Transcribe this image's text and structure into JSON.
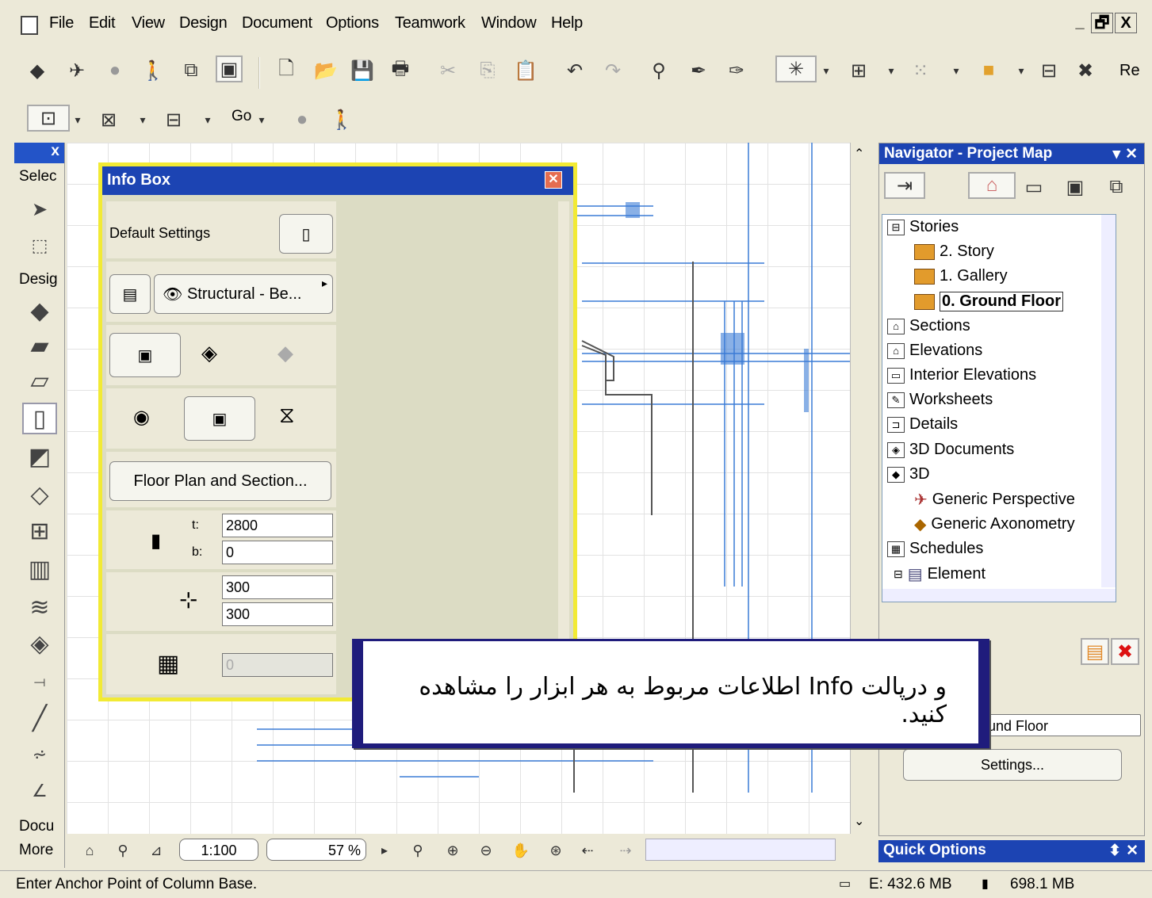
{
  "menu": {
    "items": [
      "File",
      "Edit",
      "View",
      "Design",
      "Document",
      "Options",
      "Teamwork",
      "Window",
      "Help"
    ],
    "window_buttons": [
      "_",
      "🗗",
      "X"
    ]
  },
  "toolbar2": {
    "go_label": "Go"
  },
  "toolbar1": {
    "right_text": "Re"
  },
  "toolbox": {
    "close": "x",
    "select_label": "Selec",
    "design_label": "Desig",
    "document_label": "Docu",
    "more_label": "More"
  },
  "infobox": {
    "title": "Info Box",
    "default_settings": "Default Settings",
    "layer": "Structural - Be...",
    "floor_plan_button": "Floor Plan and Section...",
    "t_label": "t:",
    "b_label": "b:",
    "t_value": "2800",
    "b_value": "0",
    "width_value": "300",
    "depth_value": "300",
    "core_value": "0"
  },
  "bottombar": {
    "scale": "1:100",
    "zoom": "57 %"
  },
  "navigator": {
    "title": "Navigator - Project Map",
    "items": [
      {
        "label": "Stories",
        "icon": "stories-icon",
        "indent": 0
      },
      {
        "label": "2. Story",
        "icon": "folder-icon",
        "indent": 1
      },
      {
        "label": "1. Gallery",
        "icon": "folder-icon",
        "indent": 1
      },
      {
        "label": "0. Ground Floor",
        "icon": "folder-icon",
        "indent": 1,
        "selected": true
      },
      {
        "label": "Sections",
        "icon": "section-icon",
        "indent": 0
      },
      {
        "label": "Elevations",
        "icon": "elevation-icon",
        "indent": 0
      },
      {
        "label": "Interior Elevations",
        "icon": "interior-elevation-icon",
        "indent": 0
      },
      {
        "label": "Worksheets",
        "icon": "worksheet-icon",
        "indent": 0
      },
      {
        "label": "Details",
        "icon": "detail-icon",
        "indent": 0
      },
      {
        "label": "3D Documents",
        "icon": "3d-document-icon",
        "indent": 0
      },
      {
        "label": "3D",
        "icon": "3d-icon",
        "indent": 0
      },
      {
        "label": "Generic Perspective",
        "icon": "camera-icon",
        "indent": 1
      },
      {
        "label": "Generic Axonometry",
        "icon": "axonometry-icon",
        "indent": 1
      },
      {
        "label": "Schedules",
        "icon": "schedule-icon",
        "indent": 0
      },
      {
        "label": "Element",
        "icon": "element-icon",
        "indent": 1
      }
    ],
    "selected_view": "und Floor",
    "settings_button": "Settings..."
  },
  "quick_options": {
    "title": "Quick Options"
  },
  "popup": {
    "text": "و درپالت Info اطلاعات مربوط به هر ابزار را مشاهده کنید."
  },
  "status": {
    "message": "Enter Anchor Point of Column Base.",
    "memory_e": "E: 432.6 MB",
    "memory_total": "698.1 MB"
  },
  "colors": {
    "title_blue": "#1c44b3",
    "infobox_border": "#f2ea34",
    "popup_border": "#1f1c7c",
    "plan_lines": "#3a7bd5"
  }
}
